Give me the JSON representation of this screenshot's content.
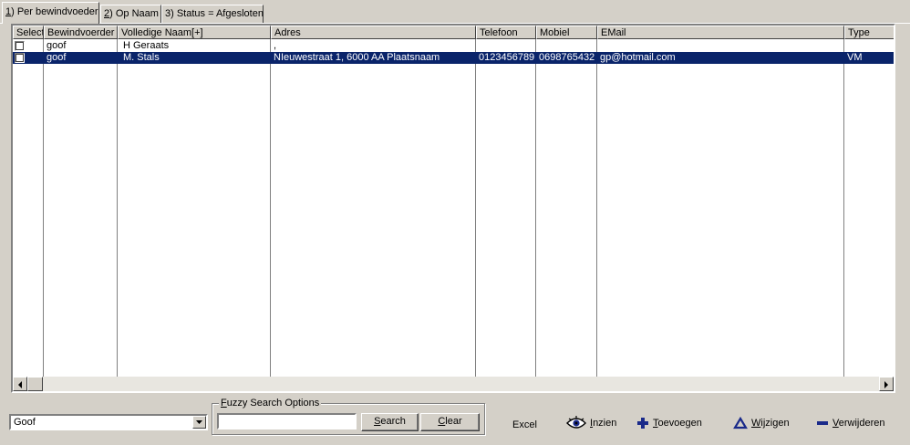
{
  "tabs": [
    {
      "key": "1",
      "label": ") Per bewindvoeder"
    },
    {
      "key": "2",
      "label": ") Op Naam"
    },
    {
      "key": "3",
      "label": "3) Status = Afgesloten"
    }
  ],
  "grid": {
    "columns": [
      "Select",
      "Bewindvoerder",
      "Volledige Naam[+]",
      "Adres",
      "Telefoon",
      "Mobiel",
      "EMail",
      "Type"
    ],
    "rows": [
      {
        "bewindvoerder": "goof",
        "naam": "H Geraats",
        "adres": ",",
        "telefoon": "",
        "mobiel": "",
        "email": "",
        "type": ""
      },
      {
        "bewindvoerder": "goof",
        "naam": "M. Stals",
        "adres": "NIeuwestraat 1, 6000 AA Plaatsnaam",
        "telefoon": "0123456789",
        "mobiel": "0698765432",
        "email": "gp@hotmail.com",
        "type": "VM"
      }
    ]
  },
  "bottom": {
    "combo_value": "Goof",
    "fuzzy": {
      "legend_u": "F",
      "legend_rest": "uzzy Search Options",
      "input_value": ""
    },
    "search_u": "S",
    "search_rest": "earch",
    "clear_u": "C",
    "clear_rest": "lear",
    "excel_label": "Excel",
    "inzien_u": "I",
    "inzien_rest": "nzien",
    "toevoegen_u": "T",
    "toevoegen_rest": "oevoegen",
    "wijzigen_u": "W",
    "wijzigen_rest": "ijzigen",
    "verwijderen_u": "V",
    "verwijderen_rest": "erwijderen"
  },
  "colors": {
    "selection": "#0a246a",
    "accent_icon": "#1a2a8a"
  }
}
